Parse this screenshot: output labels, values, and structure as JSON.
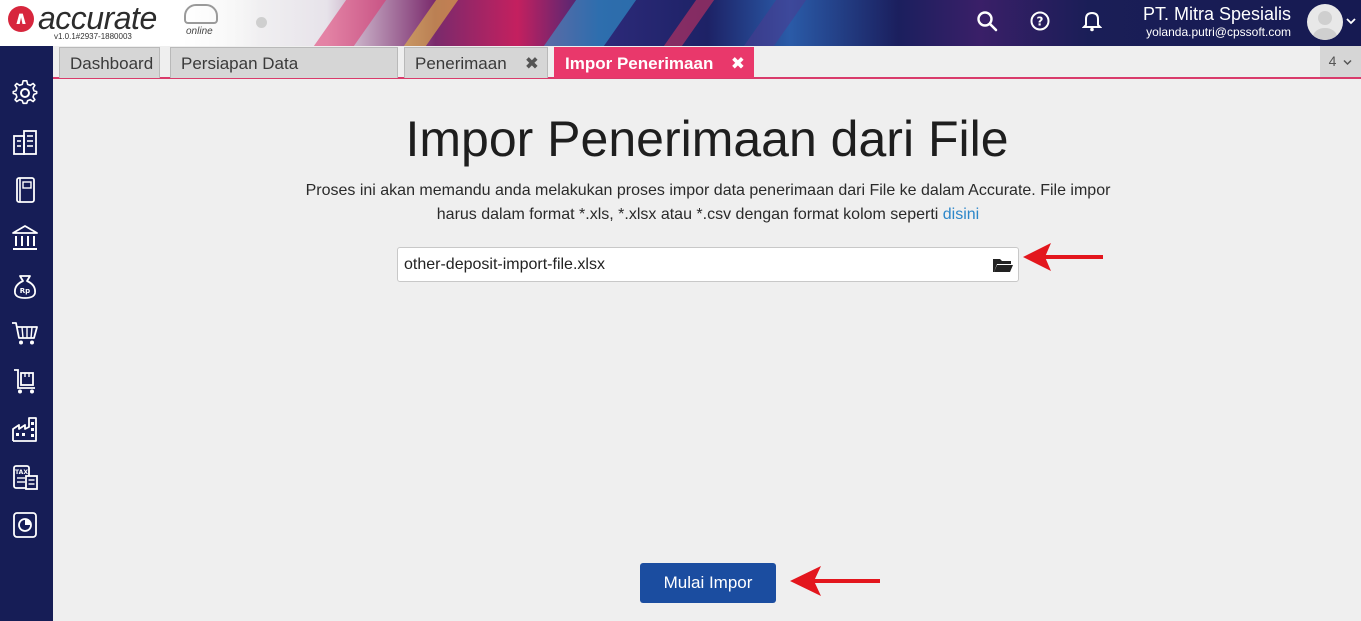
{
  "app": {
    "logo_text": "accurate",
    "logo_sub": "online",
    "version": "v1.0.1#2937-1880003"
  },
  "header": {
    "company_name": "PT. Mitra Spesialis",
    "user_email": "yolanda.putri@cpssoft.com",
    "icons": [
      "search-icon",
      "help-icon",
      "bell-icon"
    ]
  },
  "sidebar": {
    "items": [
      {
        "icon": "gear-icon"
      },
      {
        "icon": "building-icon"
      },
      {
        "icon": "ledger-book-icon"
      },
      {
        "icon": "bank-icon"
      },
      {
        "icon": "money-bag-icon"
      },
      {
        "icon": "cart-icon"
      },
      {
        "icon": "inventory-cart-icon"
      },
      {
        "icon": "factory-icon"
      },
      {
        "icon": "tax-icon"
      },
      {
        "icon": "report-chart-icon"
      }
    ]
  },
  "tabs": [
    {
      "label": "Dashboard",
      "closable": false,
      "active": false
    },
    {
      "label": "Persiapan Data Perusahaan",
      "closable": false,
      "active": false
    },
    {
      "label": "Penerimaan",
      "closable": true,
      "active": false
    },
    {
      "label": "Impor Penerimaan",
      "closable": true,
      "active": true
    }
  ],
  "tab_close_glyph": "✖",
  "tab_count": "4",
  "main": {
    "title": "Impor Penerimaan dari File",
    "description_line1": "Proses ini akan memandu anda melakukan proses impor data penerimaan dari File ke dalam Accurate. File impor",
    "description_line2": "harus dalam format *.xls, *.xlsx atau *.csv dengan format kolom seperti ",
    "description_link": "disini",
    "file_value": "other-deposit-import-file.xlsx",
    "start_button": "Mulai Impor"
  },
  "colors": {
    "sidebar_bg": "#161d56",
    "active_tab": "#e9386b",
    "primary_button": "#1b4da0",
    "link": "#2b86c9",
    "annotation_arrow": "#e3161d"
  }
}
